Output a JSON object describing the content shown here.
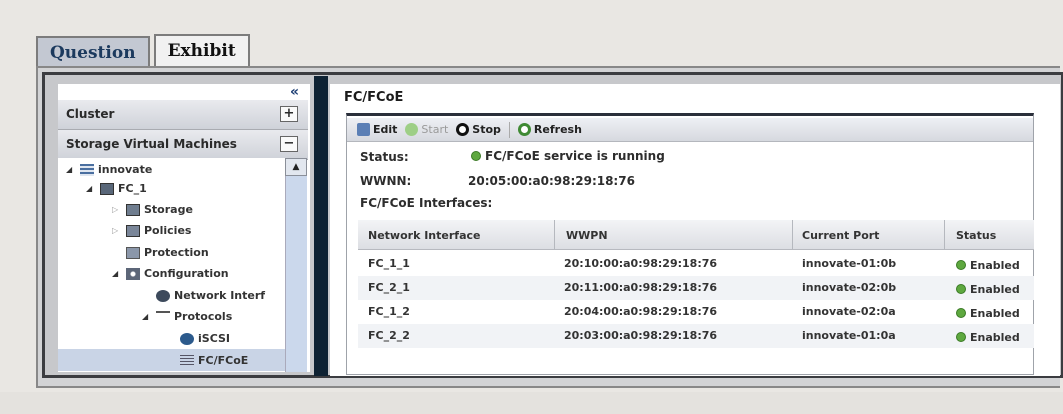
{
  "tabs": [
    {
      "label": "Question",
      "active": false
    },
    {
      "label": "Exhibit",
      "active": true
    }
  ],
  "left_panel": {
    "collapse_glyph": "«",
    "cluster_label": "Cluster",
    "cluster_button": "+",
    "svm_label": "Storage Virtual Machines",
    "svm_button": "−",
    "tree": [
      {
        "label": "innovate"
      },
      {
        "label": "FC_1"
      },
      {
        "label": "Storage"
      },
      {
        "label": "Policies"
      },
      {
        "label": "Protection"
      },
      {
        "label": "Configuration"
      },
      {
        "label": "Network Interf"
      },
      {
        "label": "Protocols"
      },
      {
        "label": "iSCSI"
      },
      {
        "label": "FC/FCoE"
      }
    ]
  },
  "right_panel": {
    "title": "FC/FCoE",
    "toolbar": {
      "edit": "Edit",
      "start": "Start",
      "stop": "Stop",
      "refresh": "Refresh"
    },
    "status_label": "Status:",
    "status_value": "FC/FCoE service is running",
    "wwnn_label": "WWNN:",
    "wwnn_value": "20:05:00:a0:98:29:18:76",
    "interfaces_label": "FC/FCoE Interfaces:",
    "table": {
      "columns": [
        "Network Interface",
        "WWPN",
        "Current Port",
        "Status"
      ],
      "rows": [
        {
          "iface": "FC_1_1",
          "wwpn": "20:10:00:a0:98:29:18:76",
          "port": "innovate-01:0b",
          "status": "Enabled"
        },
        {
          "iface": "FC_2_1",
          "wwpn": "20:11:00:a0:98:29:18:76",
          "port": "innovate-02:0b",
          "status": "Enabled"
        },
        {
          "iface": "FC_1_2",
          "wwpn": "20:04:00:a0:98:29:18:76",
          "port": "innovate-02:0a",
          "status": "Enabled"
        },
        {
          "iface": "FC_2_2",
          "wwpn": "20:03:00:a0:98:29:18:76",
          "port": "innovate-01:0a",
          "status": "Enabled"
        }
      ]
    }
  },
  "colors": {
    "accent": "#1b3c72",
    "status_green": "#5ea83f",
    "divider": "#0e2233"
  }
}
